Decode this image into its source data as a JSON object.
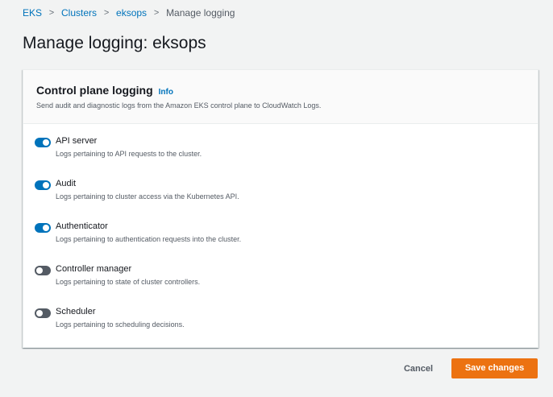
{
  "breadcrumb": {
    "items": [
      "EKS",
      "Clusters",
      "eksops"
    ],
    "current": "Manage logging",
    "separator": ">"
  },
  "page": {
    "title": "Manage logging: eksops"
  },
  "panel": {
    "title": "Control plane logging",
    "info": "Info",
    "description": "Send audit and diagnostic logs from the Amazon EKS control plane to CloudWatch Logs."
  },
  "options": [
    {
      "label": "API server",
      "description": "Logs pertaining to API requests to the cluster.",
      "enabled": true
    },
    {
      "label": "Audit",
      "description": "Logs pertaining to cluster access via the Kubernetes API.",
      "enabled": true
    },
    {
      "label": "Authenticator",
      "description": "Logs pertaining to authentication requests into the cluster.",
      "enabled": true
    },
    {
      "label": "Controller manager",
      "description": "Logs pertaining to state of cluster controllers.",
      "enabled": false
    },
    {
      "label": "Scheduler",
      "description": "Logs pertaining to scheduling decisions.",
      "enabled": false
    }
  ],
  "footer": {
    "cancel_label": "Cancel",
    "save_label": "Save changes"
  },
  "colors": {
    "accent": "#0073bb",
    "primary_button": "#ec7211",
    "toggle_off": "#545b64"
  }
}
